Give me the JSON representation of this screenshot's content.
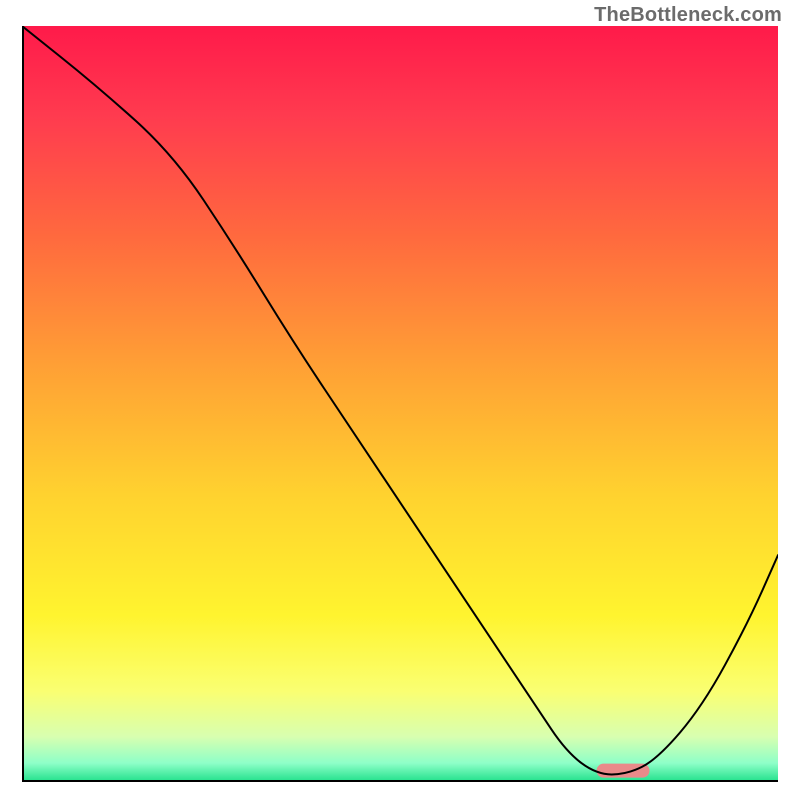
{
  "watermark": "TheBottleneck.com",
  "chart_data": {
    "type": "line",
    "title": "",
    "xlabel": "",
    "ylabel": "",
    "xlim": [
      0,
      100
    ],
    "ylim": [
      0,
      100
    ],
    "grid": false,
    "series": [
      {
        "name": "curve",
        "x": [
          0,
          10,
          20,
          28,
          36,
          44,
          52,
          60,
          68,
          72,
          76,
          80,
          84,
          90,
          96,
          100
        ],
        "y": [
          100,
          92,
          83,
          71,
          58,
          46,
          34,
          22,
          10,
          4,
          1,
          1,
          3,
          10,
          21,
          30
        ]
      }
    ],
    "marker": {
      "x_start": 76,
      "x_end": 83,
      "y": 1.5,
      "color": "#e98a8a"
    },
    "background_gradient": {
      "stops": [
        {
          "offset": 0.0,
          "color": "#ff1a4a"
        },
        {
          "offset": 0.12,
          "color": "#ff3b4f"
        },
        {
          "offset": 0.28,
          "color": "#ff6a3e"
        },
        {
          "offset": 0.45,
          "color": "#ffa035"
        },
        {
          "offset": 0.62,
          "color": "#ffd22f"
        },
        {
          "offset": 0.78,
          "color": "#fff42f"
        },
        {
          "offset": 0.88,
          "color": "#faff72"
        },
        {
          "offset": 0.94,
          "color": "#d8ffb0"
        },
        {
          "offset": 0.975,
          "color": "#8effc8"
        },
        {
          "offset": 1.0,
          "color": "#1fe08a"
        }
      ]
    },
    "axes_color": "#000000",
    "line_color": "#000000",
    "line_width": 2
  }
}
